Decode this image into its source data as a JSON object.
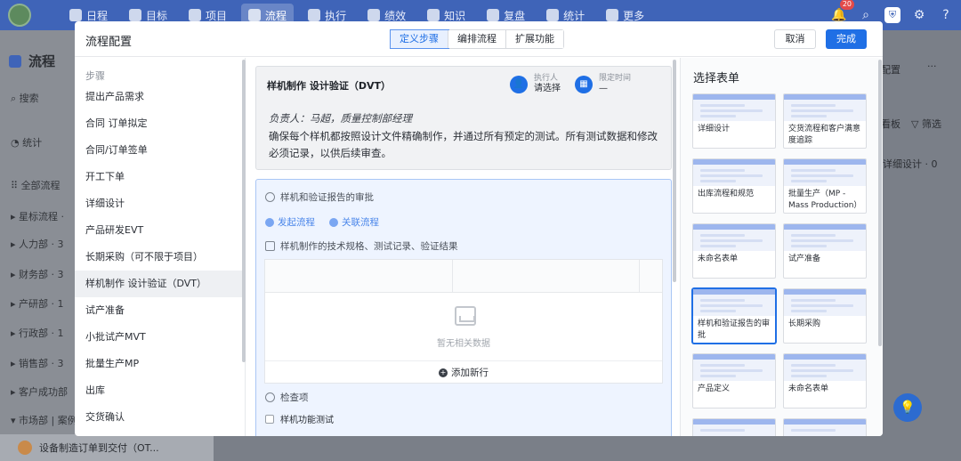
{
  "topnav": {
    "items": [
      {
        "label": "日程",
        "active": false
      },
      {
        "label": "目标",
        "active": false
      },
      {
        "label": "项目",
        "active": false
      },
      {
        "label": "流程",
        "active": true
      },
      {
        "label": "执行",
        "active": false
      },
      {
        "label": "绩效",
        "active": false
      },
      {
        "label": "知识",
        "active": false
      },
      {
        "label": "复盘",
        "active": false
      },
      {
        "label": "统计",
        "active": false
      },
      {
        "label": "更多",
        "active": false
      }
    ],
    "notification_count": "20"
  },
  "background": {
    "app_title": "流程",
    "search_label": "搜索",
    "stats_label": "统计",
    "all_flows_label": "全部流程",
    "groups": [
      {
        "label": "星标流程 ·"
      },
      {
        "label": "人力部 · 3"
      },
      {
        "label": "财务部 · 3"
      },
      {
        "label": "产研部 · 1"
      },
      {
        "label": "行政部 · 1"
      },
      {
        "label": "销售部 · 3"
      },
      {
        "label": "客户成功部"
      },
      {
        "label": "市场部 | 案例"
      }
    ],
    "bottom_item": "设备制造订单到交付（OT...",
    "right_config": "配置",
    "right_board": "看板",
    "right_filter": "筛选",
    "right_detail": "详细设计 · 0"
  },
  "modal": {
    "title": "流程配置",
    "tabs": [
      {
        "label": "定义步骤",
        "active": true
      },
      {
        "label": "编排流程",
        "active": false
      },
      {
        "label": "扩展功能",
        "active": false
      }
    ],
    "cancel_label": "取消",
    "done_label": "完成",
    "steps_header": "步骤",
    "steps": [
      {
        "label": "提出产品需求",
        "active": false
      },
      {
        "label": "合同 订单拟定",
        "active": false
      },
      {
        "label": "合同/订单签单",
        "active": false
      },
      {
        "label": "开工下单",
        "active": false
      },
      {
        "label": "详细设计",
        "active": false
      },
      {
        "label": "产品研发EVT",
        "active": false
      },
      {
        "label": "长期采购（可不限于项目）",
        "active": false
      },
      {
        "label": "样机制作 设计验证（DVT）",
        "active": true
      },
      {
        "label": "试产准备",
        "active": false
      },
      {
        "label": "小批试产MVT",
        "active": false
      },
      {
        "label": "批量生产MP",
        "active": false
      },
      {
        "label": "出库",
        "active": false
      },
      {
        "label": "交货确认",
        "active": false
      }
    ],
    "step_detail": {
      "title": "样机制作 设计验证（DVT）",
      "executor_label": "执行人",
      "executor_value": "请选择",
      "deadline_label": "限定时间",
      "deadline_value": "—",
      "owner_line": "负责人：马超，质量控制部经理",
      "description": "确保每个样机都按照设计文件精确制作，并通过所有预定的测试。所有测试数据和修改必须记录，以供后续审查。",
      "form_section": "样机和验证报告的审批",
      "start_flow": "发起流程",
      "link_flow": "关联流程",
      "table_section": "样机制作的技术规格、测试记录、验证结果",
      "empty_text": "暂无相关数据",
      "add_row": "添加新行",
      "check_section": "检查项",
      "check_item": "样机功能测试"
    },
    "picker": {
      "title": "选择表单",
      "forms": [
        {
          "name": "详细设计",
          "selected": false
        },
        {
          "name": "交货流程和客户满意度追踪",
          "selected": false
        },
        {
          "name": "出库流程和规范",
          "selected": false
        },
        {
          "name": "批量生产（MP - Mass Production）",
          "selected": false
        },
        {
          "name": "未命名表单",
          "selected": false
        },
        {
          "name": "试产准备",
          "selected": false
        },
        {
          "name": "样机和验证报告的审批",
          "selected": true
        },
        {
          "name": "长期采购",
          "selected": false
        },
        {
          "name": "产品定义",
          "selected": false
        },
        {
          "name": "未命名表单",
          "selected": false
        }
      ]
    }
  }
}
